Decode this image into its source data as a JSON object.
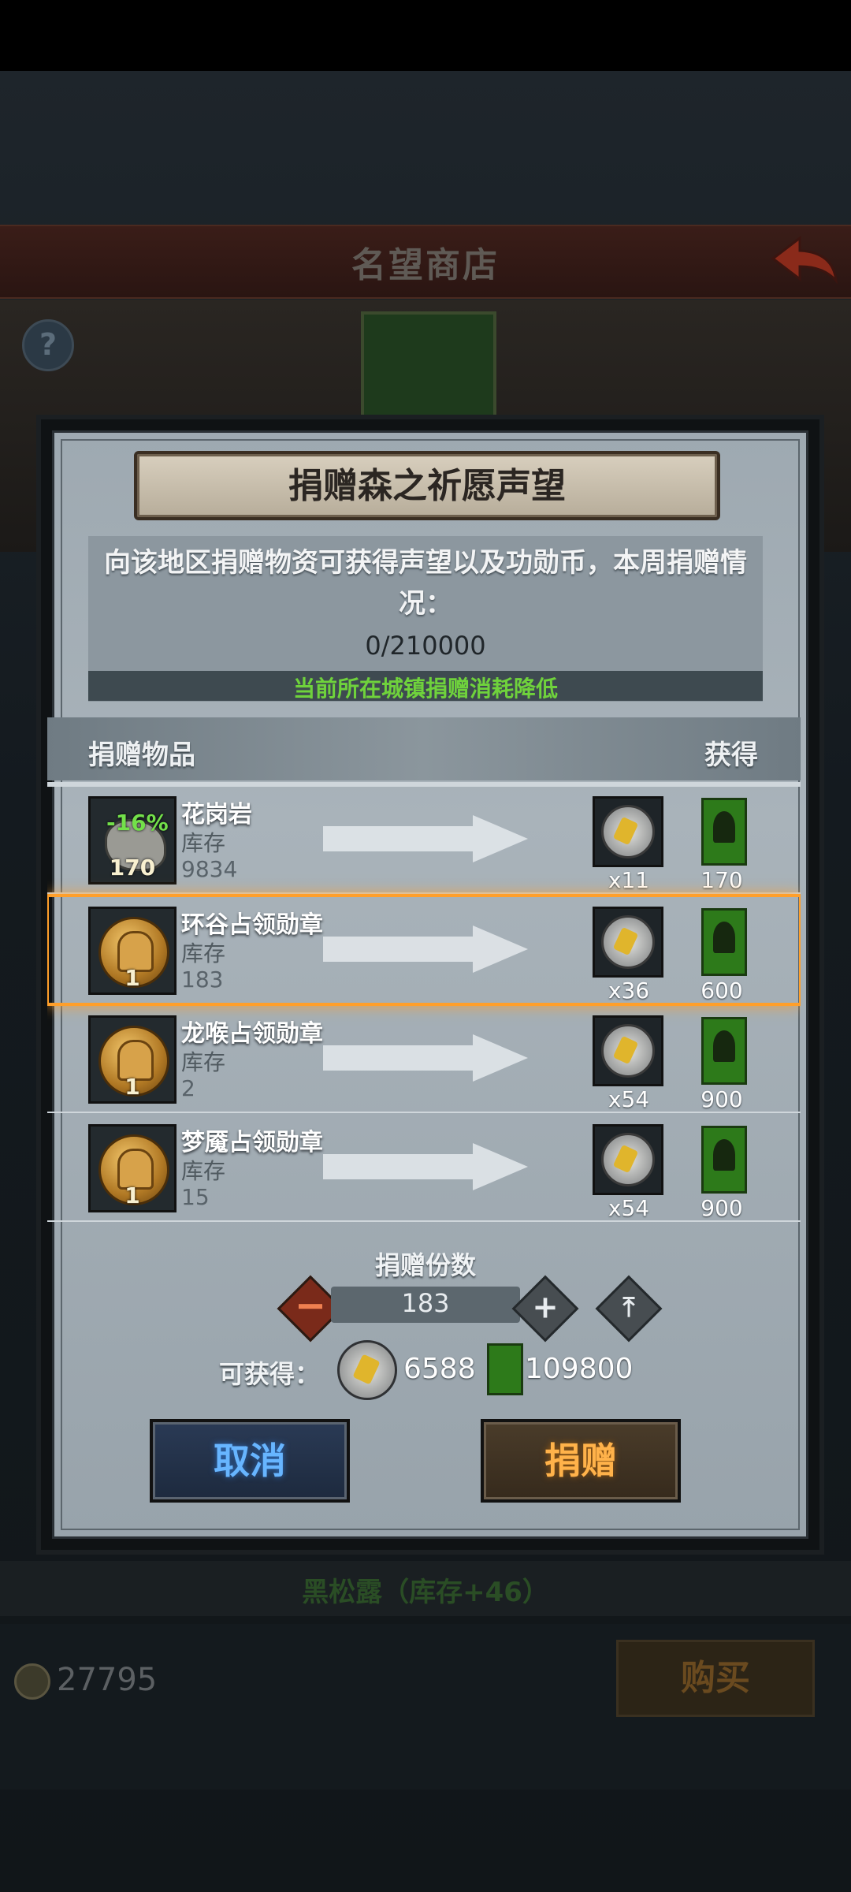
{
  "shop": {
    "title": "名望商店"
  },
  "dialog": {
    "title": "捐赠森之祈愿声望",
    "info": "向该地区捐赠物资可获得声望以及功勋币，本周捐赠情况：",
    "progress": "0/210000",
    "notice": "当前所在城镇捐赠消耗降低",
    "col_item": "捐赠物品",
    "col_gain": "获得",
    "stock_label": "库存",
    "items": [
      {
        "name": "花岗岩",
        "discount": "-16%",
        "qty": "170",
        "stock": "9834",
        "coin": "x11",
        "rep": "170"
      },
      {
        "name": "环谷占领勋章",
        "qty": "1",
        "stock": "183",
        "coin": "x36",
        "rep": "600",
        "selected": true
      },
      {
        "name": "龙喉占领勋章",
        "qty": "1",
        "stock": "2",
        "coin": "x54",
        "rep": "900"
      },
      {
        "name": "梦魇占领勋章",
        "qty": "1",
        "stock": "15",
        "coin": "x54",
        "rep": "900"
      }
    ],
    "count_label": "捐赠份数",
    "count_value": "183",
    "reward_label": "可获得：",
    "reward_coin": "6588",
    "reward_rep": "109800",
    "cancel": "取消",
    "donate": "捐赠"
  },
  "bottom": {
    "truffle": "黑松露（库存+46）",
    "coins": "27795",
    "buy": "购买"
  },
  "colors": {
    "accent_orange": "#ff9f2a",
    "green": "#6fd23c",
    "blue": "#67b5ff"
  }
}
